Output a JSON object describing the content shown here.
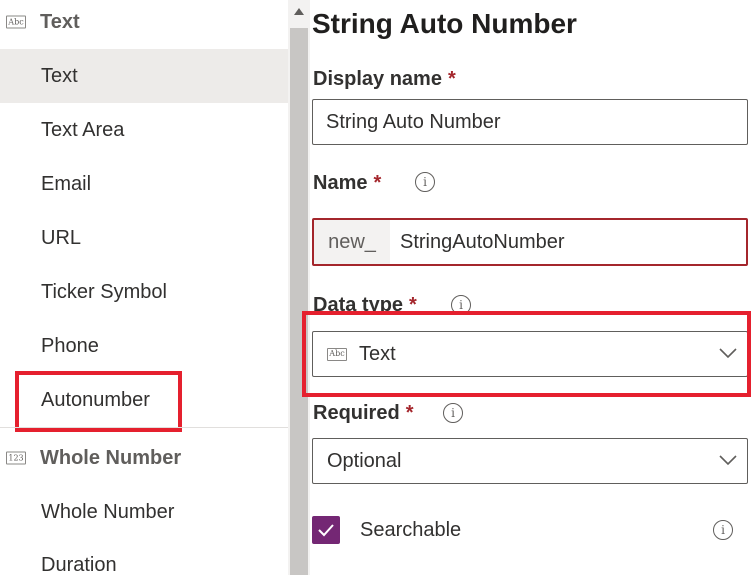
{
  "left_panel": {
    "groups": [
      {
        "icon": "Abc",
        "label": "Text",
        "items": [
          "Text",
          "Text Area",
          "Email",
          "URL",
          "Ticker Symbol",
          "Phone",
          "Autonumber"
        ]
      },
      {
        "icon": "123",
        "label": "Whole Number",
        "items": [
          "Whole Number",
          "Duration"
        ]
      }
    ],
    "selected_item": "Text",
    "highlighted_item": "Autonumber"
  },
  "form": {
    "title": "String Auto Number",
    "display_name": {
      "label": "Display name",
      "required_mark": "*",
      "value": "String Auto Number"
    },
    "name": {
      "label": "Name",
      "required_mark": "*",
      "prefix": "new_",
      "value": "StringAutoNumber",
      "info_glyph": "i"
    },
    "data_type": {
      "label": "Data type",
      "required_mark": "*",
      "value": "Text",
      "value_icon": "Abc",
      "info_glyph": "i"
    },
    "required": {
      "label": "Required",
      "required_mark": "*",
      "value": "Optional",
      "info_glyph": "i"
    },
    "searchable": {
      "label": "Searchable",
      "checked": true,
      "info_glyph": "i"
    }
  },
  "colors": {
    "accent_purple": "#742774",
    "required_red": "#a4262c",
    "highlight_red": "#e5202e",
    "selected_bg": "#edebe9"
  },
  "icons": {
    "dropdown_chevron": "chevron-down-icon",
    "info": "info-icon",
    "checkmark": "checkmark-icon",
    "scroll_up": "scroll-up-arrow-icon"
  }
}
